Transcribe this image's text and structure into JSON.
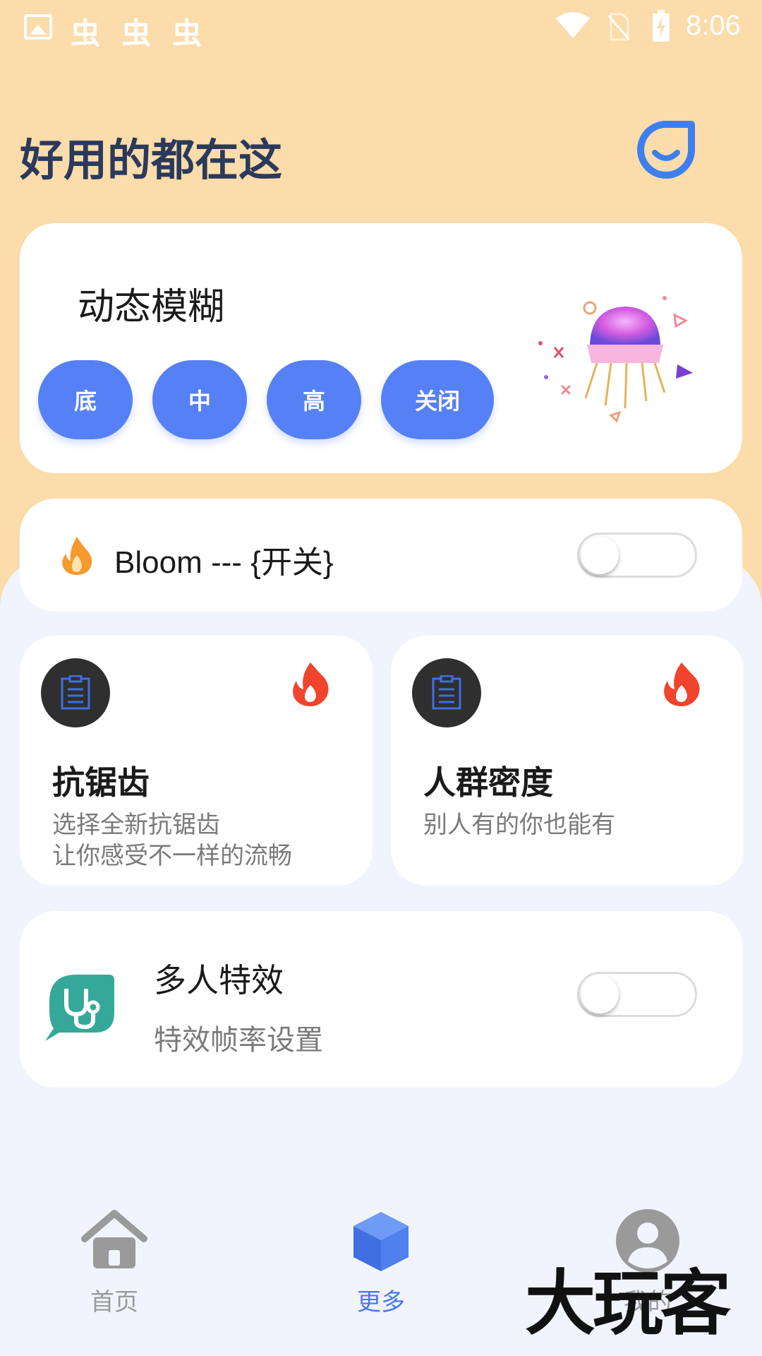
{
  "status_bar": {
    "time": "8:06",
    "notification_icons": [
      "gallery-icon",
      "bug-icon",
      "bug-icon",
      "bug-icon"
    ],
    "bug_glyph": "虫",
    "system_icons": [
      "wifi-icon",
      "no-sim-icon",
      "battery-charging-icon"
    ]
  },
  "header": {
    "title": "好用的都在这",
    "icon": "smile-icon"
  },
  "motion_blur": {
    "title": "动态模糊",
    "buttons": [
      "底",
      "中",
      "高",
      "关闭"
    ],
    "illustration": "jellyfish-illustration"
  },
  "bloom": {
    "label": "Bloom --- {开关}",
    "icon": "fire-icon",
    "toggle_on": false
  },
  "features": [
    {
      "title": "抗锯齿",
      "desc_line1": "选择全新抗锯齿",
      "desc_line2": "让你感受不一样的流畅",
      "icon": "clipboard-icon",
      "badge": "hot-icon"
    },
    {
      "title": "人群密度",
      "desc_line1": "别人有的你也能有",
      "desc_line2": "",
      "icon": "clipboard-icon",
      "badge": "hot-icon"
    }
  ],
  "multi_effect": {
    "title": "多人特效",
    "subtitle": "特效帧率设置",
    "icon": "stethoscope-chat-icon",
    "toggle_on": false
  },
  "bottom_nav": {
    "items": [
      {
        "label": "首页",
        "icon": "home-icon",
        "active": false
      },
      {
        "label": "更多",
        "icon": "cube-icon",
        "active": true
      },
      {
        "label": "我的",
        "icon": "user-icon",
        "active": false
      }
    ]
  },
  "watermark": "大玩客",
  "colors": {
    "top_background": "#fbdcaa",
    "page_background": "#f1f4fd",
    "accent_blue": "#5680f5",
    "hot_red": "#f0442c",
    "title_navy": "#2a3a5c"
  }
}
